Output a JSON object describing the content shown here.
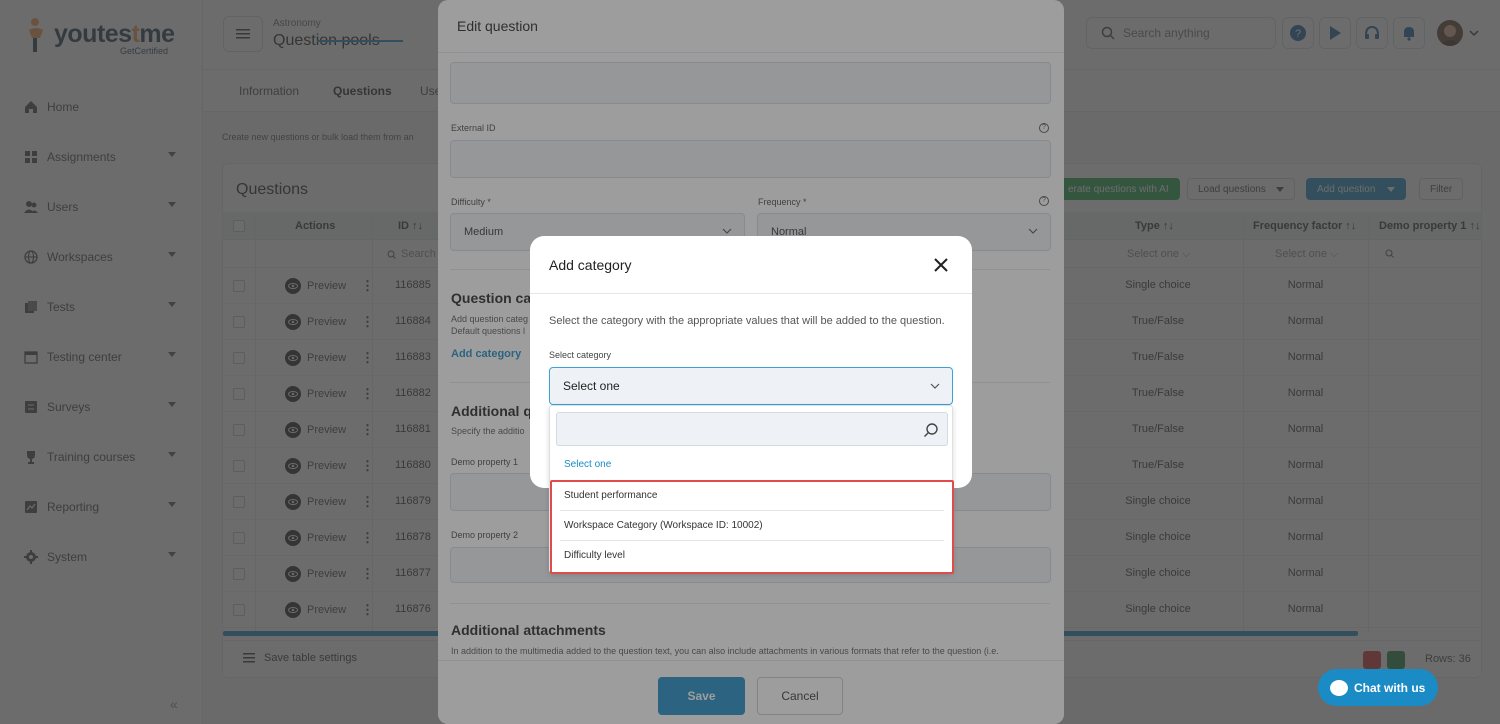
{
  "brand": {
    "logo_text_a": "youtes",
    "logo_text_t": "t",
    "logo_text_b": "me",
    "logo_sub": "GetCertified",
    "accent": "#1a8bc4",
    "orange": "#f2994a"
  },
  "sidebar": {
    "items": [
      {
        "label": "Home",
        "icon": "home-icon"
      },
      {
        "label": "Assignments",
        "icon": "assignments-icon"
      },
      {
        "label": "Users",
        "icon": "users-icon"
      },
      {
        "label": "Workspaces",
        "icon": "globe-icon"
      },
      {
        "label": "Tests",
        "icon": "tests-icon"
      },
      {
        "label": "Testing center",
        "icon": "calendar-icon"
      },
      {
        "label": "Surveys",
        "icon": "survey-icon"
      },
      {
        "label": "Training courses",
        "icon": "trophy-icon"
      },
      {
        "label": "Reporting",
        "icon": "report-icon"
      },
      {
        "label": "System",
        "icon": "gear-icon"
      }
    ]
  },
  "header": {
    "breadcrumb": "Astronomy",
    "title": "Question pools",
    "search_placeholder": "Search anything"
  },
  "tabs": [
    "Information",
    "Questions",
    "Use"
  ],
  "page": {
    "description": "Create new questions or bulk load them from an"
  },
  "questions": {
    "title": "Questions",
    "buttons": {
      "generate": "erate questions with AI",
      "load": "Load questions",
      "add": "Add question",
      "filter": "Filter"
    },
    "columns": {
      "actions": "Actions",
      "id": "ID ↑↓",
      "type": "Type ↑↓",
      "frequency": "Frequency factor ↑↓",
      "demo": "Demo property 1 ↑↓"
    },
    "filters": {
      "id": "Search",
      "type": "Select one",
      "frequency": "Select one"
    },
    "preview_label": "Preview",
    "rows": [
      {
        "id": "116885",
        "type": "Single choice",
        "freq": "Normal"
      },
      {
        "id": "116884",
        "type": "True/False",
        "freq": "Normal"
      },
      {
        "id": "116883",
        "type": "True/False",
        "freq": "Normal"
      },
      {
        "id": "116882",
        "type": "True/False",
        "freq": "Normal"
      },
      {
        "id": "116881",
        "type": "True/False",
        "freq": "Normal"
      },
      {
        "id": "116880",
        "type": "True/False",
        "freq": "Normal"
      },
      {
        "id": "116879",
        "type": "Single choice",
        "freq": "Normal"
      },
      {
        "id": "116878",
        "type": "Single choice",
        "freq": "Normal"
      },
      {
        "id": "116877",
        "type": "Single choice",
        "freq": "Normal"
      },
      {
        "id": "116876",
        "type": "Single choice",
        "freq": "Normal"
      }
    ],
    "save_settings": "Save table settings",
    "rows_count": "Rows: 36"
  },
  "edit_modal": {
    "title": "Edit question",
    "external_id_label": "External ID",
    "difficulty_label": "Difficulty *",
    "difficulty_value": "Medium",
    "frequency_label": "Frequency *",
    "frequency_value": "Normal",
    "question_categories_title": "Question cat",
    "question_categories_desc1": "Add question categ",
    "question_categories_desc2": "Default questions l",
    "add_category_link": "Add category",
    "additional_title": "Additional q",
    "additional_desc": "Specify the additio",
    "demo1_label": "Demo property 1",
    "demo2_label": "Demo property 2",
    "attachments_title": "Additional attachments",
    "attachments_desc": "In addition to the multimedia added to the question text, you can also include attachments in various formats that refer to the question (i.e.",
    "save": "Save",
    "cancel": "Cancel"
  },
  "category_modal": {
    "title": "Add category",
    "description": "Select the category with the appropriate values that will be added to the question.",
    "select_label": "Select category",
    "select_value": "Select one",
    "dropdown": {
      "placeholder_option": "Select one",
      "options": [
        "Student performance",
        "Workspace Category (Workspace ID: 10002)",
        "Difficulty level"
      ]
    }
  },
  "chat": {
    "label": "Chat with us"
  }
}
